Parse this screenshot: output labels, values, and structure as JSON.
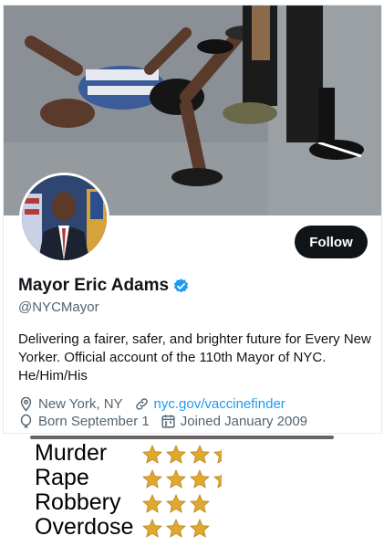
{
  "profile": {
    "display_name": "Mayor Eric Adams",
    "handle": "@NYCMayor",
    "bio": "Delivering a fairer, safer, and brighter future for Every New Yorker. Official account of the 110th Mayor of NYC. He/Him/His",
    "follow_label": "Follow",
    "location": "New York, NY",
    "website": "nyc.gov/vaccinefinder",
    "born": "Born September 1",
    "joined": "Joined January 2009",
    "verified_color": "#1d9bf0"
  },
  "ratings": [
    {
      "label": "Murder",
      "stars": 3.5
    },
    {
      "label": "Rape",
      "stars": 3.5
    },
    {
      "label": "Robbery",
      "stars": 3
    },
    {
      "label": "Overdose",
      "stars": 3
    }
  ],
  "colors": {
    "accent": "#1d9bf0",
    "button_bg": "#0f1419",
    "star_gold": "#e0a82e"
  }
}
